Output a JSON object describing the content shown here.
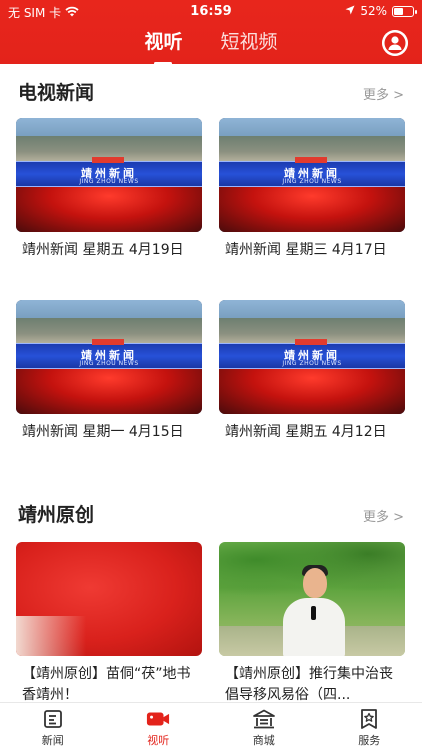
{
  "status_bar": {
    "carrier": "无 SIM 卡",
    "time": "16:59",
    "battery": "52%"
  },
  "header": {
    "tabs": [
      {
        "label": "视听",
        "active": true
      },
      {
        "label": "短视频",
        "active": false
      }
    ],
    "profile_icon": "user-icon"
  },
  "sections": [
    {
      "title": "电视新闻",
      "more": "更多 >",
      "items": [
        {
          "title": "靖州新闻 星期五 4月19日",
          "thumb_title": "靖州新闻",
          "thumb_sub": "JING ZHOU NEWS"
        },
        {
          "title": "靖州新闻 星期三 4月17日",
          "thumb_title": "靖州新闻",
          "thumb_sub": "JING ZHOU NEWS"
        },
        {
          "title": "靖州新闻 星期一 4月15日",
          "thumb_title": "靖州新闻",
          "thumb_sub": "JING ZHOU NEWS"
        },
        {
          "title": "靖州新闻 星期五 4月12日",
          "thumb_title": "靖州新闻",
          "thumb_sub": "JING ZHOU NEWS"
        }
      ]
    },
    {
      "title": "靖州原创",
      "more": "更多 >",
      "items": [
        {
          "title": "【靖州原创】苗侗“茯”地书香靖州！"
        },
        {
          "title": "【靖州原创】推行集中治丧 倡导移风易俗（四..."
        }
      ]
    }
  ],
  "tabbar": [
    {
      "label": "新闻",
      "icon": "news-icon",
      "active": false
    },
    {
      "label": "视听",
      "icon": "video-camera-icon",
      "active": true
    },
    {
      "label": "商城",
      "icon": "store-icon",
      "active": false
    },
    {
      "label": "服务",
      "icon": "service-icon",
      "active": false
    }
  ],
  "colors": {
    "brand": "#e3231b",
    "text": "#222222",
    "muted": "#999999"
  }
}
